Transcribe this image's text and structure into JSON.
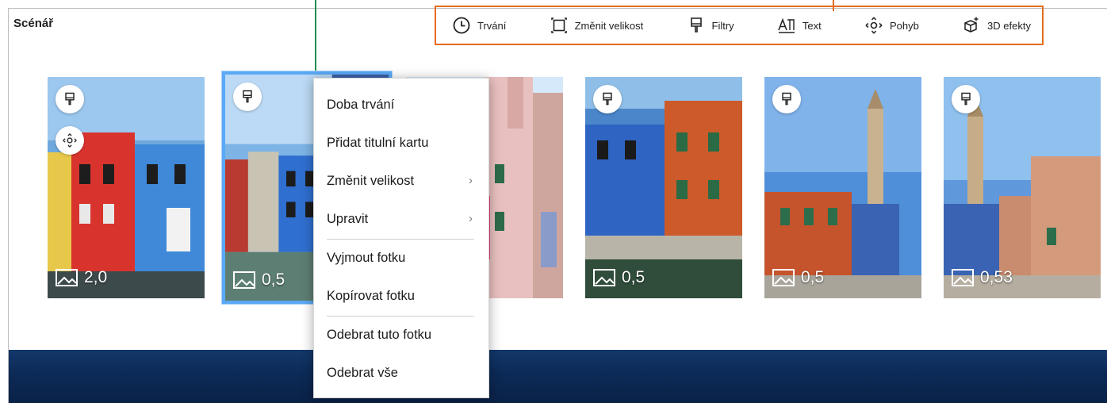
{
  "panel": {
    "title": "Scénář"
  },
  "toolbar": {
    "items": [
      {
        "label": "Trvání",
        "icon": "clock-icon"
      },
      {
        "label": "Změnit velikost",
        "icon": "resize-icon"
      },
      {
        "label": "Filtry",
        "icon": "filter-brush-icon"
      },
      {
        "label": "Text",
        "icon": "text-icon"
      },
      {
        "label": "Pohyb",
        "icon": "motion-icon"
      },
      {
        "label": "3D efekty",
        "icon": "sparkle-3d-icon"
      }
    ],
    "highlight_color": "#e56b1f"
  },
  "cards": [
    {
      "duration": "2,0",
      "badges": [
        "filter-brush-icon",
        "motion-icon"
      ]
    },
    {
      "duration": "0,5",
      "badges": [
        "filter-brush-icon"
      ],
      "selected": true
    },
    {
      "duration": "",
      "badges": []
    },
    {
      "duration": "0,5",
      "badges": [
        "filter-brush-icon"
      ]
    },
    {
      "duration": "0,5",
      "badges": [
        "filter-brush-icon"
      ]
    },
    {
      "duration": "0,53",
      "badges": [
        "filter-brush-icon"
      ]
    }
  ],
  "context_menu": {
    "items": [
      {
        "label": "Doba trvání"
      },
      {
        "label": "Přidat titulní kartu"
      },
      {
        "label": "Změnit velikost",
        "submenu": true
      },
      {
        "label": "Upravit",
        "submenu": true
      },
      {
        "label": "Vyjmout fotku"
      },
      {
        "label": "Kopírovat fotku"
      },
      {
        "label": "Odebrat tuto fotku"
      },
      {
        "label": "Odebrat vše"
      }
    ],
    "chevron": "›"
  },
  "colors": {
    "selection": "#5aa9f5",
    "callout_line": "#1f8f4d"
  }
}
